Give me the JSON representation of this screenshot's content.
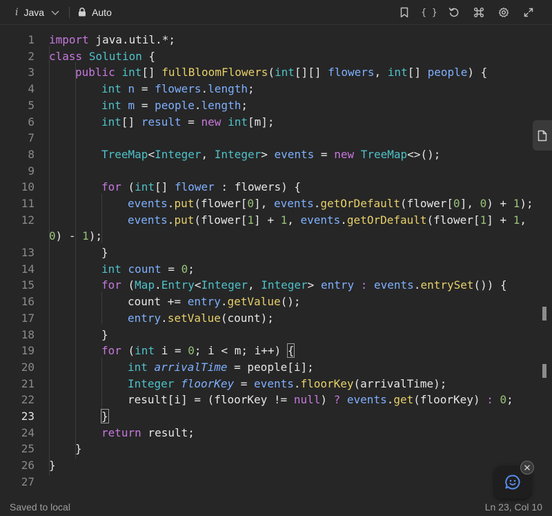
{
  "toolbar": {
    "language": "Java",
    "language_icon_glyph": "i",
    "mode": "Auto",
    "icons": [
      "bookmark-icon",
      "braces-icon",
      "reset-icon",
      "command-icon",
      "gear-icon",
      "expand-icon"
    ],
    "braces_glyph": "{ }"
  },
  "editor": {
    "active_line": 23,
    "lines": [
      {
        "n": "1"
      },
      {
        "n": "2"
      },
      {
        "n": "3"
      },
      {
        "n": "4"
      },
      {
        "n": "5"
      },
      {
        "n": "6"
      },
      {
        "n": "7"
      },
      {
        "n": "8"
      },
      {
        "n": "9"
      },
      {
        "n": "10"
      },
      {
        "n": "11"
      },
      {
        "n": "12"
      },
      {
        "n": "13"
      },
      {
        "n": "14"
      },
      {
        "n": "15"
      },
      {
        "n": "16"
      },
      {
        "n": "17"
      },
      {
        "n": "18"
      },
      {
        "n": "19"
      },
      {
        "n": "20"
      },
      {
        "n": "21"
      },
      {
        "n": "22"
      },
      {
        "n": "23"
      },
      {
        "n": "24"
      },
      {
        "n": "25"
      },
      {
        "n": "26"
      },
      {
        "n": "27"
      }
    ],
    "tokens": {
      "l1": [
        "import",
        " java.util.*;"
      ],
      "l2": [
        "class",
        " ",
        "Solution",
        " {"
      ],
      "l3": [
        "public",
        " ",
        "int",
        "[] ",
        "fullBloomFlowers",
        "(",
        "int",
        "[][] ",
        "flowers",
        ", ",
        "int",
        "[] ",
        "people",
        ") {"
      ],
      "l4": [
        "int",
        " ",
        "n",
        " = ",
        "flowers",
        ".",
        "length",
        ";"
      ],
      "l5": [
        "int",
        " ",
        "m",
        " = ",
        "people",
        ".",
        "length",
        ";"
      ],
      "l6": [
        "int",
        "[] ",
        "result",
        " = ",
        "new",
        " ",
        "int",
        "[m];"
      ],
      "l8": [
        "TreeMap",
        "<",
        "Integer",
        ", ",
        "Integer",
        "> ",
        "events",
        " = ",
        "new",
        " ",
        "TreeMap",
        "<>();"
      ],
      "l10": [
        "for",
        " (",
        "int",
        "[] ",
        "flower",
        " : ",
        "flowers) {"
      ],
      "l11": [
        "events",
        ".",
        "put",
        "(flower[",
        "0",
        "], ",
        "events",
        ".",
        "getOrDefault",
        "(flower[",
        "0",
        "], ",
        "0",
        ") + ",
        "1",
        ");"
      ],
      "l12a": [
        "events",
        ".",
        "put",
        "(flower[",
        "1",
        "] + ",
        "1",
        ", ",
        "events",
        ".",
        "getOrDefault",
        "(flower[",
        "1",
        "] + ",
        "1",
        ","
      ],
      "l12b": [
        "0",
        ") - ",
        "1",
        ");"
      ],
      "l13": [
        "}"
      ],
      "l14": [
        "int",
        " ",
        "count",
        " = ",
        "0",
        ";"
      ],
      "l15": [
        "for",
        " (",
        "Map",
        ".",
        "Entry",
        "<",
        "Integer",
        ", ",
        "Integer",
        "> ",
        "entry",
        " : ",
        "events",
        ".",
        "entrySet",
        "()) {"
      ],
      "l16": [
        "count",
        " += ",
        "entry",
        ".",
        "getValue",
        "();"
      ],
      "l17": [
        "entry",
        ".",
        "setValue",
        "(count);"
      ],
      "l18": [
        "}"
      ],
      "l19": [
        "for",
        " (",
        "int",
        " i = ",
        "0",
        "; i < m; i++) ",
        "{"
      ],
      "l20": [
        "int",
        " ",
        "arrivalTime",
        " = people[i];"
      ],
      "l21": [
        "Integer",
        " ",
        "floorKey",
        " = ",
        "events",
        ".",
        "floorKey",
        "(arrivalTime);"
      ],
      "l22": [
        "result[i] = (floorKey != ",
        "null",
        ") ",
        "?",
        " ",
        "events",
        ".",
        "get",
        "(floorKey) ",
        ":",
        " ",
        "0",
        ";"
      ],
      "l23": [
        "}"
      ],
      "l24": [
        "return",
        " result;"
      ],
      "l25": [
        "}"
      ],
      "l26": [
        "}"
      ]
    }
  },
  "status": {
    "left": "Saved to local",
    "right": "Ln 23, Col 10"
  },
  "colors": {
    "keyword": "#c678dd",
    "type": "#4fc1c9",
    "variable": "#7fb0ff",
    "function": "#e7d06a",
    "number": "#98c379",
    "background": "#262626"
  }
}
